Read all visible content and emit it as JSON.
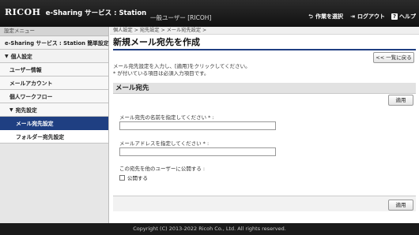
{
  "header": {
    "logo": "RICOH",
    "product": "e-Sharing サービス : Station",
    "user": "一般ユーザー [RICOH]",
    "nav": [
      {
        "label": "作業を選択",
        "icon": "task-switch-icon"
      },
      {
        "label": "ログアウト",
        "icon": "logout-icon"
      },
      {
        "label": "ヘルプ",
        "icon": "help-icon"
      }
    ]
  },
  "sidebar": {
    "title": "設定メニュー",
    "items": [
      {
        "label": "e-Sharing サービス : Station 簡単設定"
      },
      {
        "label": "個人設定"
      },
      {
        "label": "ユーザー情報"
      },
      {
        "label": "メールアカウント"
      },
      {
        "label": "個人ワークフロー"
      },
      {
        "label": "宛先設定"
      },
      {
        "label": "メール宛先設定"
      },
      {
        "label": "フォルダー宛先設定"
      }
    ]
  },
  "main": {
    "breadcrumb": "個人設定 > 宛先設定 > メール宛先設定 >",
    "title": "新規メール宛先を作成",
    "back_label": "<< 一覧に戻る",
    "desc_line1": "メール宛先設定を入力し、[適用]をクリックしてください。",
    "desc_line2": "* が付いている項目は必須入力項目です。",
    "section_title": "メール宛先",
    "apply_label": "適用",
    "name_label": "メール宛先の名前を指定してください * :",
    "name_value": "",
    "email_label": "メールアドレスを指定してください * :",
    "email_value": "",
    "share_label": "この宛先を他のユーザーに公開する :",
    "public_label": "公開する"
  },
  "footer": {
    "copyright": "Copyright (C) 2013-2022 Ricoh Co., Ltd. All rights reserved."
  }
}
